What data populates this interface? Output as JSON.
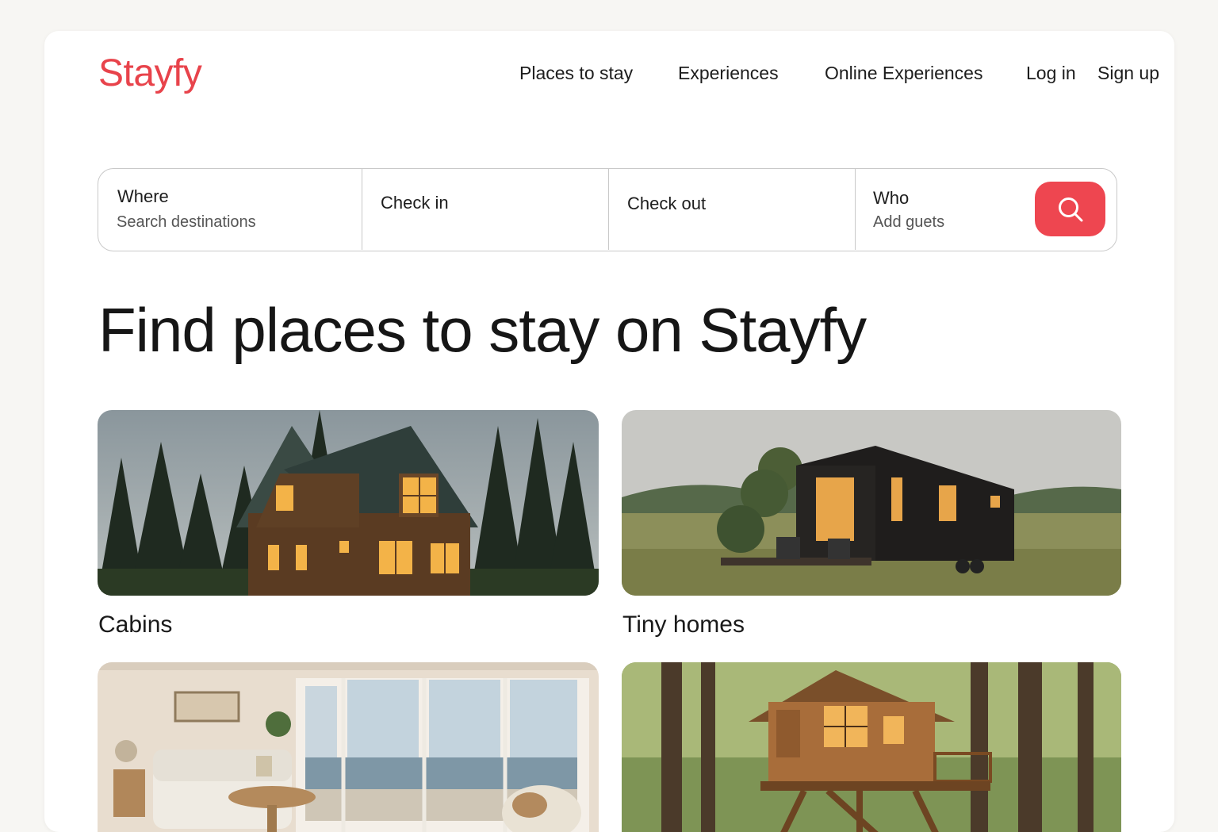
{
  "brand": {
    "name": "Stayfy",
    "color": "#e8434b"
  },
  "nav": {
    "places": "Places to stay",
    "experiences": "Experiences",
    "online": "Online Experiences",
    "login": "Log in",
    "signup": "Sign up"
  },
  "search": {
    "where_label": "Where",
    "where_hint": "Search destinations",
    "checkin_label": "Check in",
    "checkout_label": "Check out",
    "who_label": "Who",
    "who_hint": "Add guets",
    "button_icon": "search-icon",
    "button_color": "#ee4650"
  },
  "headline": "Find places to stay on Stayfy",
  "categories": [
    {
      "label": "Cabins",
      "image": "log-cabin-in-forest"
    },
    {
      "label": "Tiny homes",
      "image": "black-tiny-home-in-meadow"
    },
    {
      "label": "",
      "image": "bright-living-room-ocean-view"
    },
    {
      "label": "",
      "image": "treehouse-in-forest"
    }
  ]
}
